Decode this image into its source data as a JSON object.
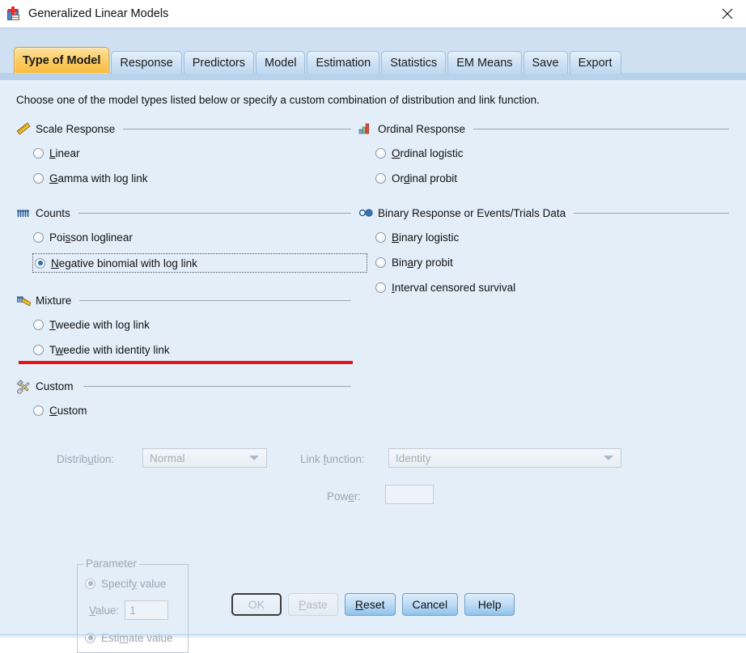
{
  "window": {
    "title": "Generalized Linear Models",
    "icon": "spss-dialog-icon",
    "close_icon": "close-icon"
  },
  "tabs": [
    {
      "label": "Type of Model",
      "active": true
    },
    {
      "label": "Response",
      "active": false
    },
    {
      "label": "Predictors",
      "active": false
    },
    {
      "label": "Model",
      "active": false
    },
    {
      "label": "Estimation",
      "active": false
    },
    {
      "label": "Statistics",
      "active": false
    },
    {
      "label": "EM Means",
      "active": false
    },
    {
      "label": "Save",
      "active": false
    },
    {
      "label": "Export",
      "active": false
    }
  ],
  "instruction": "Choose one of the model types listed below or specify a custom combination of distribution and link function.",
  "groups": {
    "scale_response": {
      "title": "Scale Response",
      "icon": "ruler-icon",
      "options": [
        {
          "pre": "",
          "mn": "L",
          "post": "inear",
          "checked": false
        },
        {
          "pre": "",
          "mn": "G",
          "post": "amma with log link",
          "checked": false
        }
      ]
    },
    "counts": {
      "title": "Counts",
      "icon": "counts-bars-icon",
      "options": [
        {
          "pre": "Poi",
          "mn": "s",
          "post": "son loglinear",
          "checked": false
        },
        {
          "pre": "",
          "mn": "N",
          "post": "egative binomial with log link",
          "checked": true,
          "focused": true
        }
      ]
    },
    "mixture": {
      "title": "Mixture",
      "icon": "mixture-icon",
      "options": [
        {
          "pre": "",
          "mn": "T",
          "post": "weedie with log link",
          "checked": false
        },
        {
          "pre": "T",
          "mn": "w",
          "post": "eedie with identity link",
          "checked": false
        }
      ]
    },
    "custom_group": {
      "title": "Custom",
      "icon": "hammer-wrench-icon",
      "options": [
        {
          "pre": "",
          "mn": "C",
          "post": "ustom",
          "checked": false
        }
      ]
    },
    "ordinal_response": {
      "title": "Ordinal Response",
      "icon": "bar-chart-icon",
      "options": [
        {
          "pre": "",
          "mn": "O",
          "post": "rdinal logistic",
          "checked": false
        },
        {
          "pre": "Or",
          "mn": "d",
          "post": "inal probit",
          "checked": false
        }
      ]
    },
    "binary_response": {
      "title": "Binary Response or Events/Trials Data",
      "icon": "two-circles-icon",
      "options": [
        {
          "pre": "",
          "mn": "B",
          "post": "inary logistic",
          "checked": false
        },
        {
          "pre": "Bin",
          "mn": "a",
          "post": "ry probit",
          "checked": false
        },
        {
          "pre": "",
          "mn": "I",
          "post": "nterval censored survival",
          "checked": false
        }
      ]
    }
  },
  "custom_controls": {
    "distribution": {
      "label_pre": "Distrib",
      "label_mn": "u",
      "label_post": "tion:",
      "value": "Normal",
      "enabled": false,
      "arrow_icon": "chevron-down-icon"
    },
    "link_function": {
      "label_pre": "Link ",
      "label_mn": "f",
      "label_post": "unction:",
      "value": "Identity",
      "enabled": false,
      "arrow_icon": "chevron-down-icon"
    },
    "power": {
      "label_pre": "Pow",
      "label_mn": "e",
      "label_post": "r:",
      "value": "",
      "enabled": false
    },
    "parameter": {
      "legend": "Parameter",
      "specify": {
        "pre": "Specif",
        "mn": "y",
        "post": " value",
        "checked": true,
        "enabled": false
      },
      "value_label": {
        "pre": "",
        "mn": "V",
        "post": "alue:"
      },
      "value": "1",
      "estimate": {
        "pre": "Esti",
        "mn": "m",
        "post": "ate value",
        "checked": false,
        "enabled": false
      }
    }
  },
  "footer": {
    "buttons": [
      {
        "pre": "",
        "mn": "",
        "post": "OK",
        "enabled": false,
        "focus": true
      },
      {
        "pre": "",
        "mn": "P",
        "post": "aste",
        "enabled": false,
        "focus": false
      },
      {
        "pre": "",
        "mn": "R",
        "post": "eset",
        "enabled": true,
        "focus": false
      },
      {
        "pre": "",
        "mn": "",
        "post": "Cancel",
        "enabled": true,
        "focus": false
      },
      {
        "pre": "",
        "mn": "",
        "post": "Help",
        "enabled": true,
        "focus": false
      }
    ]
  },
  "annotation": {
    "type": "red-underline",
    "color": "#e81414",
    "target": "Negative binomial with log link"
  },
  "colors": {
    "panel_bg": "#e4eef9",
    "tabstrip_bg": "#cfe0f2",
    "active_tab": "#fcca5f",
    "inactive_tab": "#cfe2f5",
    "accent_blue": "#2a6fb5",
    "annotation_red": "#e81414",
    "disabled_text": "#9aa6b4"
  }
}
